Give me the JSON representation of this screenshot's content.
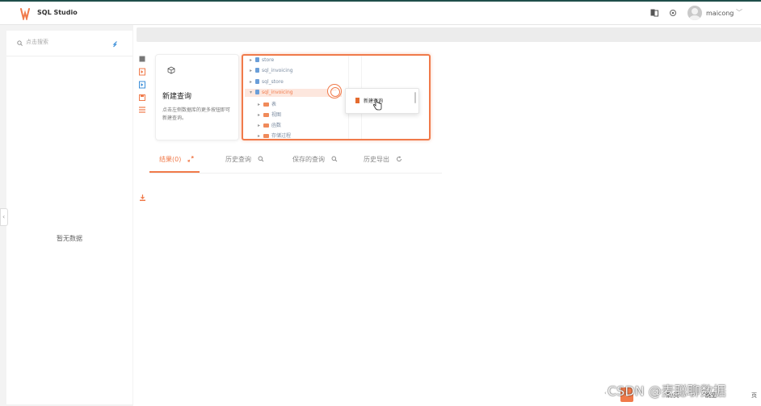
{
  "app": {
    "title": "SQL Studio",
    "brand_color": "#f07a4a"
  },
  "header": {
    "username": "maicong",
    "icons": [
      "translate-icon",
      "settings-icon"
    ]
  },
  "sidebar": {
    "search_placeholder": "点击搜索",
    "empty_text": "暂无数据"
  },
  "card": {
    "title": "新建查询",
    "description": "点击左侧数据库的更多按钮即可新建查询。"
  },
  "demo": {
    "tree": [
      {
        "label": "store",
        "type": "db"
      },
      {
        "label": "sql_invoicing",
        "type": "db"
      },
      {
        "label": "sql_store",
        "type": "db"
      },
      {
        "label": "sql_invoicing",
        "type": "db",
        "highlighted": true
      },
      {
        "label": "表",
        "type": "folder"
      },
      {
        "label": "视图",
        "type": "folder"
      },
      {
        "label": "函数",
        "type": "folder"
      },
      {
        "label": "存储过程",
        "type": "folder"
      }
    ],
    "context_menu_item": "新建查询",
    "more_dots": "···"
  },
  "tabs": [
    {
      "label": "结果(0)",
      "icon": "expand-icon",
      "active": true
    },
    {
      "label": "历史查询",
      "icon": "search-icon"
    },
    {
      "label": "保存的查询",
      "icon": "search-icon"
    },
    {
      "label": "历史导出",
      "icon": "refresh-icon"
    }
  ],
  "pager": {
    "prev": "‹",
    "current": "1",
    "text1": "条/页",
    "text2": "跳至",
    "page_suffix": "页"
  },
  "watermark": "CSDN @麦聪聊数据"
}
